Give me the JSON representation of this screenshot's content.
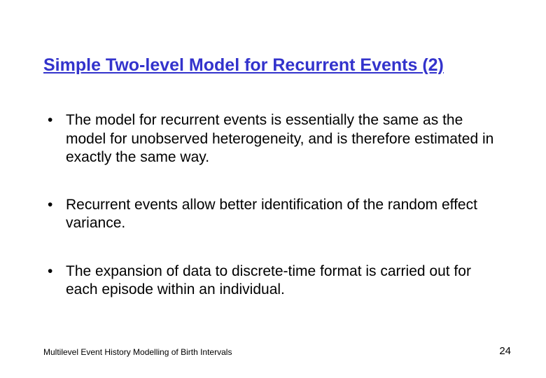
{
  "title": "Simple Two-level Model for Recurrent Events (2)",
  "bullets": [
    "The model for recurrent events is essentially the same as the model for unobserved heterogeneity, and is therefore estimated in exactly the same way.",
    "Recurrent events allow better identification of the random effect variance.",
    "The expansion of data to discrete-time format is carried out for each episode within an individual."
  ],
  "footer": "Multilevel Event History Modelling of Birth Intervals",
  "page_number": "24"
}
